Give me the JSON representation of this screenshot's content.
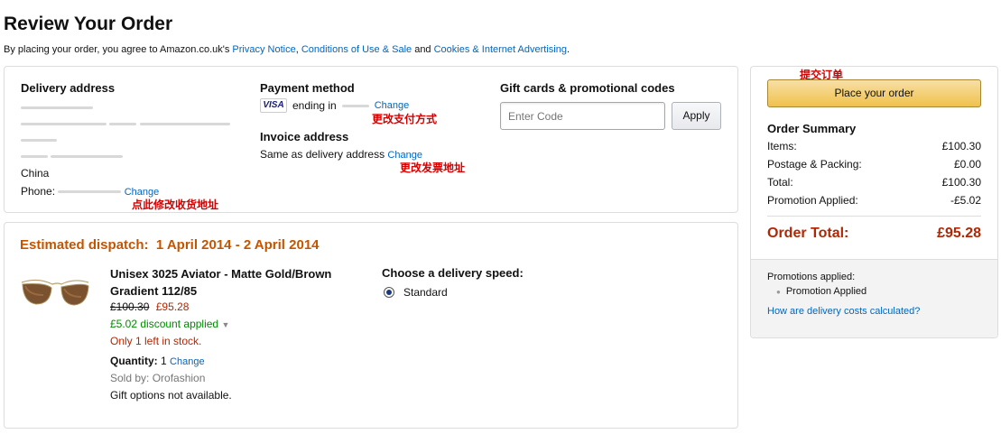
{
  "page": {
    "title": "Review Your Order",
    "agreement_prefix": "By placing your order, you agree to Amazon.co.uk's ",
    "privacy_notice": "Privacy Notice",
    "comma": ", ",
    "conditions": "Conditions of Use & Sale",
    "and": " and ",
    "cookies": "Cookies & Internet Advertising",
    "period": "."
  },
  "delivery": {
    "heading": "Delivery address",
    "country": "China",
    "phone_label": "Phone:",
    "change": "Change",
    "annotation": "点此修改收货地址"
  },
  "payment": {
    "heading": "Payment method",
    "card_brand": "VISA",
    "ending_text": "ending in",
    "change": "Change",
    "annotation": "更改支付方式"
  },
  "invoice": {
    "heading": "Invoice address",
    "value": "Same as delivery address",
    "change": "Change",
    "annotation": "更改发票地址"
  },
  "gift": {
    "heading": "Gift cards & promotional codes",
    "placeholder": "Enter Code",
    "apply": "Apply"
  },
  "dispatch": {
    "heading": "Estimated dispatch:  1 April 2014 - 2 April 2014",
    "product_title": "Unisex 3025 Aviator - Matte Gold/Brown Gradient 112/85",
    "old_price": "£100.30",
    "new_price": "£95.28",
    "discount": "£5.02 discount applied",
    "stock": "Only 1 left in stock.",
    "quantity_label": "Quantity:",
    "quantity_value": "1",
    "quantity_change": "Change",
    "sold_by": "Sold by: Orofashion",
    "gift_options": "Gift options not available.",
    "speed_heading": "Choose a delivery speed:",
    "speed_option": "Standard"
  },
  "summary": {
    "annotation": "提交订单",
    "place_order": "Place your order",
    "heading": "Order Summary",
    "rows": [
      {
        "label": "Items:",
        "value": "£100.30"
      },
      {
        "label": "Postage & Packing:",
        "value": "£0.00"
      },
      {
        "label": "Total:",
        "value": "£100.30"
      },
      {
        "label": "Promotion Applied:",
        "value": "-£5.02"
      }
    ],
    "order_total_label": "Order Total:",
    "order_total_value": "£95.28",
    "promotions_heading": "Promotions applied:",
    "promotion_item": "Promotion Applied",
    "delivery_costs_link": "How are delivery costs calculated?"
  },
  "colors": {
    "dispatch_orange": "#c45500",
    "price_red": "#b12704",
    "discount_green": "#008a00",
    "link_blue": "#0066c0",
    "annotation_red": "#d40000"
  }
}
